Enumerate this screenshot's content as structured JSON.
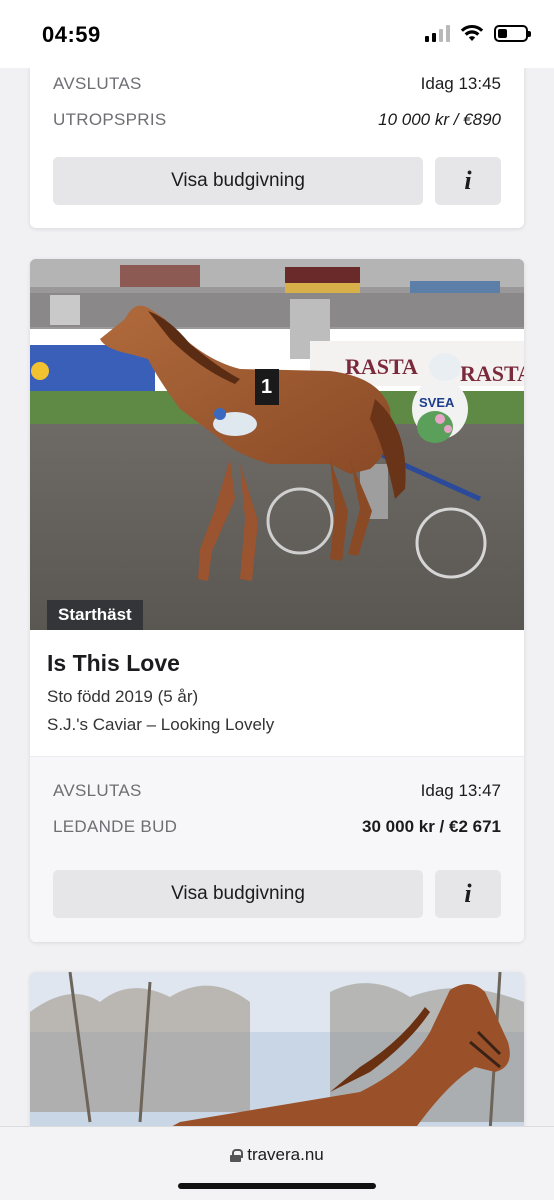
{
  "status_bar": {
    "time": "04:59",
    "battery_level": 0.35
  },
  "cards": [
    {
      "rows": [
        {
          "label": "AVSLUTAS",
          "value": "Idag 13:45"
        },
        {
          "label": "UTROPSPRIS",
          "value": "10 000 kr / €890"
        }
      ],
      "button_label": "Visa budgivning",
      "info_glyph": "i"
    },
    {
      "badge": "Starthäst",
      "photo_texts": {
        "sponsor_board": "RASTA",
        "sponsor_board_2": "RASTA",
        "bib_number": "1",
        "driver_helmet": "SVEA"
      },
      "name": "Is This Love",
      "info": "Sto född 2019 (5 år)",
      "pedigree": "S.J.'s Caviar – Looking Lovely",
      "rows": [
        {
          "label": "AVSLUTAS",
          "value": "Idag 13:47"
        },
        {
          "label": "LEDANDE BUD",
          "value": "30 000 kr / €2 671"
        }
      ],
      "button_label": "Visa budgivning",
      "info_glyph": "i"
    }
  ],
  "url_bar": {
    "domain": "travera.nu"
  }
}
